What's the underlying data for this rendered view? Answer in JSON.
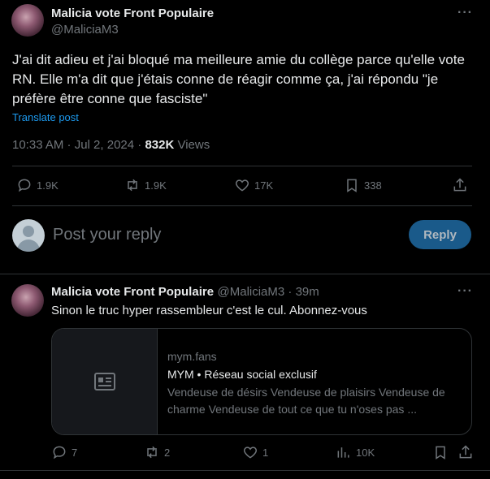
{
  "main_tweet": {
    "display_name": "Malicia vote Front Populaire",
    "handle": "@MaliciaM3",
    "text": "J'ai dit adieu et j'ai bloqué ma meilleure amie du collège parce qu'elle vote RN. Elle m'a dit que j'étais conne de réagir comme ça, j'ai répondu \"je préfère être conne que fasciste\"",
    "translate_label": "Translate post",
    "timestamp": "10:33 AM · Jul 2, 2024 · ",
    "views_count": "832K",
    "views_label": " Views",
    "replies": "1.9K",
    "reposts": "1.9K",
    "likes": "17K",
    "bookmarks": "338"
  },
  "composer": {
    "placeholder": "Post your reply",
    "button_label": "Reply"
  },
  "reply_tweet": {
    "display_name": "Malicia vote Front Populaire",
    "handle_time": "@MaliciaM3 · 39m",
    "text": "Sinon le truc hyper rassembleur c'est le cul. Abonnez-vous",
    "card": {
      "domain": "mym.fans",
      "title": "MYM • Réseau social exclusif",
      "description": "Vendeuse de désirs Vendeuse de plaisirs Vendeuse de charme Vendeuse de tout ce que tu n'oses pas ..."
    },
    "replies": "7",
    "reposts": "2",
    "likes": "1",
    "views": "10K"
  },
  "icons": {
    "more": "more-horizontal-icon",
    "reply": "comment-icon",
    "repost": "repost-icon",
    "like": "heart-icon",
    "bookmark": "bookmark-icon",
    "share": "share-icon",
    "views": "analytics-icon",
    "card": "article-icon"
  },
  "colors": {
    "background": "#000000",
    "link": "#1d9bf0",
    "muted": "#71767b",
    "divider": "#2f3336",
    "reply_button": "#1a5a8a"
  }
}
